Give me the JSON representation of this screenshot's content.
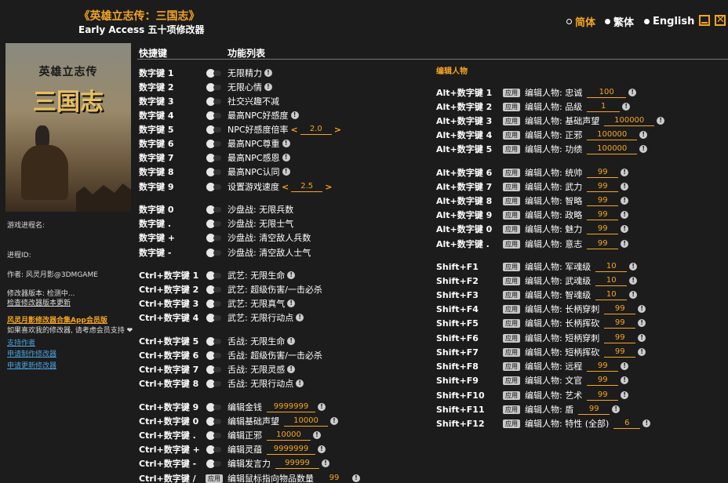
{
  "header": {
    "title": "《英雄立志传：三国志》",
    "subtitle": "Early Access 五十项修改器"
  },
  "languages": [
    {
      "label": "简体",
      "active": true
    },
    {
      "label": "繁体",
      "active": false
    },
    {
      "label": "English",
      "active": false
    }
  ],
  "window_controls": {
    "minimize_icon": "minimize-icon",
    "close_icon": "close-icon"
  },
  "cover": {
    "line1": "英雄立志传",
    "line2": "三国志"
  },
  "sidebar": {
    "process_label": "游戏进程名:",
    "pid_label": "进程ID:",
    "author": "作者: 风灵月影@3DMGAME",
    "version_line": "修改器版本: 检测中...",
    "check_update": "检查修改器版本更新",
    "vip_link": "风灵月影修改器合集App会员版",
    "support_text": "如果喜欢我的修改器, 请考虑会员支持",
    "support_link": "支持作者",
    "request_link": "申请制作修改器",
    "update_link": "申请更新修改器"
  },
  "columns": {
    "hotkey": "快捷键",
    "features": "功能列表",
    "edit_section": "编辑人物"
  },
  "apply_label": "应用",
  "left_rows": [
    {
      "key": "数字键 1",
      "label": "无限精力",
      "info": true
    },
    {
      "key": "数字键 2",
      "label": "无限心情",
      "info": true
    },
    {
      "key": "数字键 3",
      "label": "社交兴趣不减"
    },
    {
      "key": "数字键 4",
      "label": "最高NPC好感度",
      "info": true
    },
    {
      "key": "数字键 5",
      "label": "NPC好感度倍率",
      "slider": "2.0"
    },
    {
      "key": "数字键 6",
      "label": "最高NPC尊重",
      "info": true
    },
    {
      "key": "数字键 7",
      "label": "最高NPC感恩",
      "info": true
    },
    {
      "key": "数字键 8",
      "label": "最高NPC认同",
      "info": true
    },
    {
      "key": "数字键 9",
      "label": "设置游戏速度",
      "slider": "2.5"
    },
    {
      "key": "数字键 0",
      "label": "沙盘战: 无限兵数"
    },
    {
      "key": "数字键 .",
      "label": "沙盘战: 无限士气"
    },
    {
      "key": "数字键 +",
      "label": "沙盘战: 清空敌人兵数"
    },
    {
      "key": "数字键 -",
      "label": "沙盘战: 清空敌人士气"
    },
    {
      "key": "Ctrl+数字键 1",
      "label": "武艺: 无限生命",
      "info": true
    },
    {
      "key": "Ctrl+数字键 2",
      "label": "武艺: 超级伤害/一击必杀"
    },
    {
      "key": "Ctrl+数字键 3",
      "label": "武艺: 无限真气",
      "info": true
    },
    {
      "key": "Ctrl+数字键 4",
      "label": "武艺: 无限行动点",
      "info": true
    },
    {
      "key": "Ctrl+数字键 5",
      "label": "舌战: 无限生命",
      "info": true
    },
    {
      "key": "Ctrl+数字键 6",
      "label": "舌战: 超级伤害/一击必杀"
    },
    {
      "key": "Ctrl+数字键 7",
      "label": "舌战: 无限灵感",
      "info": true
    },
    {
      "key": "Ctrl+数字键 8",
      "label": "舌战: 无限行动点",
      "info": true
    },
    {
      "key": "Ctrl+数字键 9",
      "label": "编辑金钱",
      "value": "9999999",
      "info": true
    },
    {
      "key": "Ctrl+数字键 0",
      "label": "编辑基础声望",
      "value": "10000",
      "info": true
    },
    {
      "key": "Ctrl+数字键 .",
      "label": "编辑正邪",
      "value": "10000",
      "info": true
    },
    {
      "key": "Ctrl+数字键 +",
      "label": "编辑灵蕴",
      "value": "9999999",
      "info": true
    },
    {
      "key": "Ctrl+数字键 -",
      "label": "编辑发言力",
      "value": "99999",
      "info": true
    },
    {
      "key": "Ctrl+数字键 /",
      "label": "编辑鼠标指向物品数量",
      "value": "99",
      "info": true,
      "apply": true
    }
  ],
  "right_rows": [
    {
      "key": "Alt+数字键 1",
      "label": "编辑人物: 忠诚",
      "value": "100"
    },
    {
      "key": "Alt+数字键 2",
      "label": "编辑人物: 品级",
      "value": "1"
    },
    {
      "key": "Alt+数字键 3",
      "label": "编辑人物: 基础声望",
      "value": "100000"
    },
    {
      "key": "Alt+数字键 4",
      "label": "编辑人物: 正邪",
      "value": "100000"
    },
    {
      "key": "Alt+数字键 5",
      "label": "编辑人物: 功绩",
      "value": "100000"
    },
    {
      "key": "Alt+数字键 6",
      "label": "编辑人物: 统帅",
      "value": "99"
    },
    {
      "key": "Alt+数字键 7",
      "label": "编辑人物: 武力",
      "value": "99"
    },
    {
      "key": "Alt+数字键 8",
      "label": "编辑人物: 智略",
      "value": "99"
    },
    {
      "key": "Alt+数字键 9",
      "label": "编辑人物: 政略",
      "value": "99"
    },
    {
      "key": "Alt+数字键 0",
      "label": "编辑人物: 魅力",
      "value": "99"
    },
    {
      "key": "Alt+数字键 .",
      "label": "编辑人物: 意志",
      "value": "99"
    },
    {
      "key": "Shift+F1",
      "label": "编辑人物: 军魂级",
      "value": "10"
    },
    {
      "key": "Shift+F2",
      "label": "编辑人物: 武魂级",
      "value": "10"
    },
    {
      "key": "Shift+F3",
      "label": "编辑人物: 智魂级",
      "value": "10"
    },
    {
      "key": "Shift+F4",
      "label": "编辑人物: 长柄穿刺",
      "value": "99"
    },
    {
      "key": "Shift+F5",
      "label": "编辑人物: 长柄挥砍",
      "value": "99"
    },
    {
      "key": "Shift+F6",
      "label": "编辑人物: 短柄穿刺",
      "value": "99"
    },
    {
      "key": "Shift+F7",
      "label": "编辑人物: 短柄挥砍",
      "value": "99"
    },
    {
      "key": "Shift+F8",
      "label": "编辑人物: 远程",
      "value": "99"
    },
    {
      "key": "Shift+F9",
      "label": "编辑人物: 文官",
      "value": "99"
    },
    {
      "key": "Shift+F10",
      "label": "编辑人物: 艺术",
      "value": "99"
    },
    {
      "key": "Shift+F11",
      "label": "编辑人物: 盾",
      "value": "99"
    },
    {
      "key": "Shift+F12",
      "label": "编辑人物: 特性 (全部)",
      "value": "6"
    }
  ],
  "colors": {
    "accent": "#f5a623",
    "background": "#1c1c1c",
    "link": "#4aa3df"
  }
}
